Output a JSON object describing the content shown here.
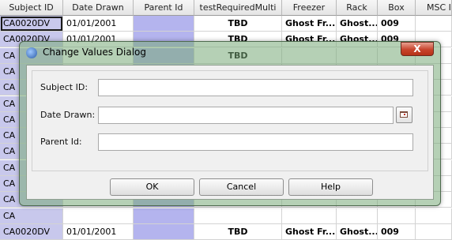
{
  "grid": {
    "columns": [
      "Subject ID",
      "Date Drawn",
      "Parent Id",
      "testRequiredMulti",
      "Freezer",
      "Rack",
      "Box",
      "MSC Ic"
    ],
    "rows": [
      [
        "CA0020DV",
        "01/01/2001",
        "",
        "TBD",
        "Ghost Fr...",
        "Ghost...",
        "009",
        ""
      ],
      [
        "CA0020DV",
        "01/01/2001",
        "",
        "TBD",
        "Ghost Fr...",
        "Ghost...",
        "009",
        ""
      ],
      [
        "CA",
        "",
        "",
        "TBD",
        "",
        "",
        "",
        ""
      ],
      [
        "CA",
        "",
        "",
        "",
        "",
        "",
        "",
        ""
      ],
      [
        "CA",
        "",
        "",
        "",
        "",
        "",
        "",
        ""
      ],
      [
        "CA",
        "",
        "",
        "",
        "",
        "",
        "",
        ""
      ],
      [
        "CA",
        "",
        "",
        "",
        "",
        "",
        "",
        ""
      ],
      [
        "CA",
        "",
        "",
        "",
        "",
        "",
        "",
        ""
      ],
      [
        "CA",
        "",
        "",
        "",
        "",
        "",
        "",
        ""
      ],
      [
        "CA",
        "",
        "",
        "",
        "",
        "",
        "",
        ""
      ],
      [
        "CA",
        "",
        "",
        "",
        "",
        "",
        "",
        ""
      ],
      [
        "CA",
        "",
        "",
        "",
        "",
        "",
        "",
        ""
      ],
      [
        "CA",
        "",
        "",
        "",
        "",
        "",
        "",
        ""
      ],
      [
        "CA0020DV",
        "01/01/2001",
        "",
        "TBD",
        "Ghost Fr...",
        "Ghost...",
        "009",
        ""
      ]
    ]
  },
  "dialog": {
    "title": "Change Values Dialog",
    "close_label": "X",
    "fields": {
      "subject_id": {
        "label": "Subject ID:",
        "value": ""
      },
      "date_drawn": {
        "label": "Date Drawn:",
        "value": ""
      },
      "parent_id": {
        "label": "Parent Id:",
        "value": ""
      }
    },
    "buttons": {
      "ok": "OK",
      "cancel": "Cancel",
      "help": "Help"
    }
  },
  "colors": {
    "subject_column": "#c8c8ec",
    "parent_column": "#b4b4ee",
    "dialog_glass": "#78aa78",
    "close_button": "#c8442c"
  }
}
